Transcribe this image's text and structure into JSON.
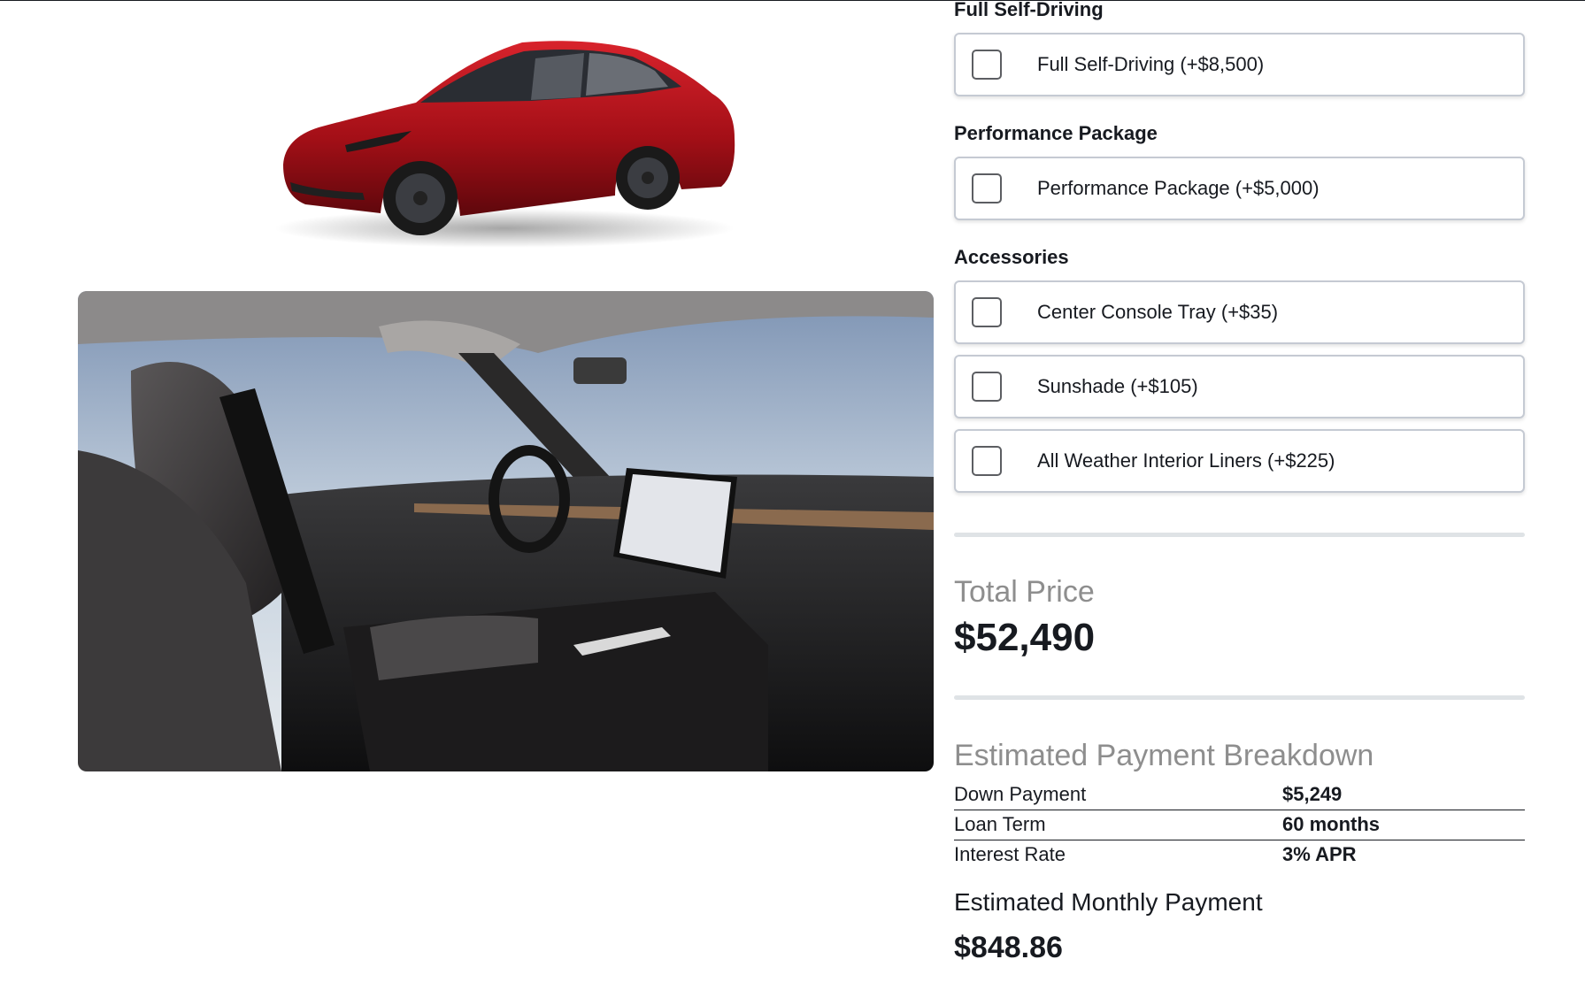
{
  "sections": {
    "fsd_title": "Full Self-Driving",
    "performance_title": "Performance Package",
    "accessories_title": "Accessories"
  },
  "options": {
    "fsd": {
      "label": "Full Self-Driving (+$8,500)",
      "checked": false
    },
    "performance": {
      "label": "Performance Package (+$5,000)",
      "checked": false
    },
    "center_console_tray": {
      "label": "Center Console Tray (+$35)",
      "checked": false
    },
    "sunshade": {
      "label": "Sunshade (+$105)",
      "checked": false
    },
    "all_weather_liners": {
      "label": "All Weather Interior Liners (+$225)",
      "checked": false
    }
  },
  "total": {
    "label": "Total Price",
    "value": "$52,490"
  },
  "breakdown": {
    "title": "Estimated Payment Breakdown",
    "rows": [
      {
        "key": "Down Payment",
        "value": "$5,249"
      },
      {
        "key": "Loan Term",
        "value": "60 months"
      },
      {
        "key": "Interest Rate",
        "value": "3% APR"
      }
    ]
  },
  "monthly": {
    "label": "Estimated Monthly Payment",
    "value": "$848.86"
  },
  "images": {
    "exterior": "red-car-exterior-image",
    "interior": "car-interior-image"
  },
  "colors": {
    "car_red": "#b3121b",
    "text": "#171a20",
    "muted": "#8e8e8e",
    "divider": "#dfe3e6"
  }
}
